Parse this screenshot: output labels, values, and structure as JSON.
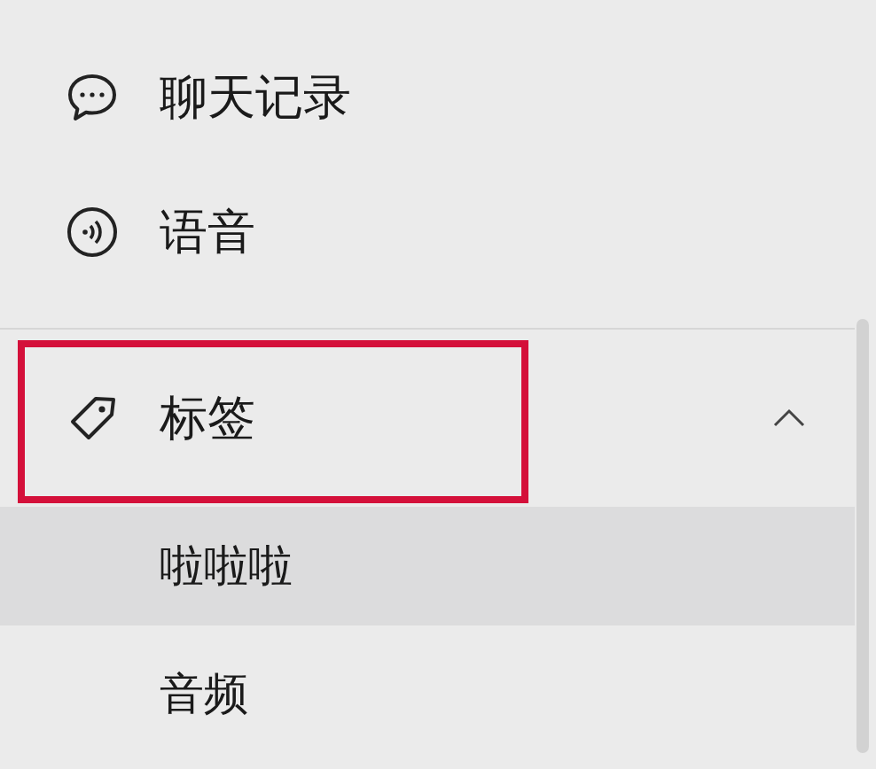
{
  "menu": [
    {
      "kind": "chat",
      "label": "聊天记录"
    },
    {
      "kind": "voice",
      "label": "语音"
    }
  ],
  "tags_section": {
    "label": "标签",
    "expanded": true,
    "highlighted": true,
    "children": [
      {
        "label": "啦啦啦",
        "selected": true
      },
      {
        "label": "音频",
        "selected": false
      }
    ]
  }
}
